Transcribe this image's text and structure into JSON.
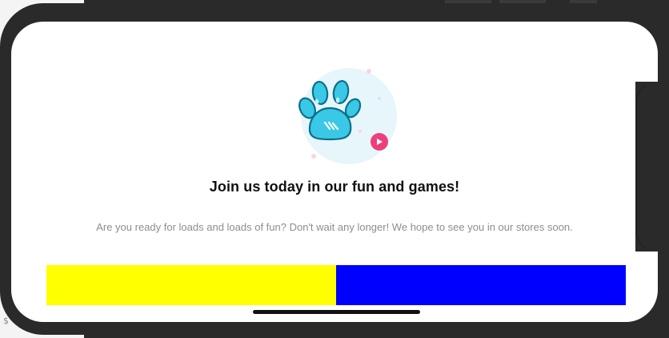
{
  "background": {
    "dollar_glyph": "$"
  },
  "onboarding": {
    "illustration_icon": "paw-icon",
    "play_badge_icon": "play-icon",
    "title": "Join us today in our fun and games!",
    "subtitle": "Are you ready for loads and loads of fun? Don't wait any longer! We hope to see you in our stores soon.",
    "left_button": {
      "label": "",
      "color": "#ffff00"
    },
    "right_button": {
      "label": "",
      "color": "#0000ff"
    }
  },
  "colors": {
    "paw_fill": "#39c9e6",
    "paw_stroke": "#0d6f8a",
    "halo": "#e6f6fb",
    "play_badge": "#ee3f7c",
    "title": "#111111",
    "subtitle": "#8d8d8d"
  }
}
